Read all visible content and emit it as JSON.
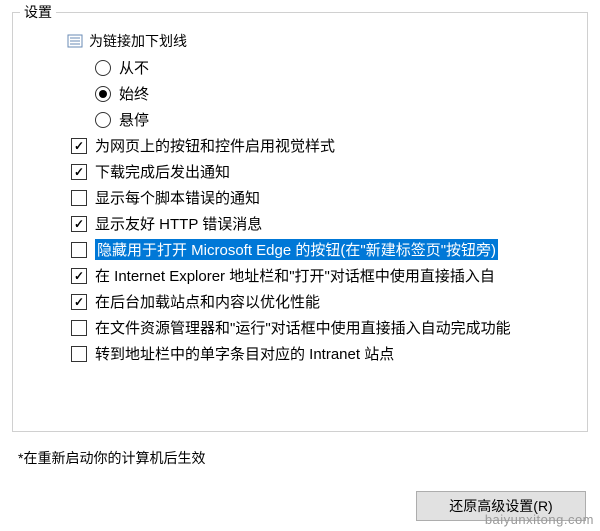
{
  "group_title": "设置",
  "tree": {
    "header": "为链接加下划线",
    "radios": [
      {
        "label": "从不",
        "selected": false
      },
      {
        "label": "始终",
        "selected": true
      },
      {
        "label": "悬停",
        "selected": false
      }
    ],
    "checks": [
      {
        "label": "为网页上的按钮和控件启用视觉样式",
        "checked": true,
        "highlighted": false
      },
      {
        "label": "下载完成后发出通知",
        "checked": true,
        "highlighted": false
      },
      {
        "label": "显示每个脚本错误的通知",
        "checked": false,
        "highlighted": false
      },
      {
        "label": "显示友好 HTTP 错误消息",
        "checked": true,
        "highlighted": false
      },
      {
        "label": "隐藏用于打开 Microsoft Edge 的按钮(在\"新建标签页\"按钮旁)",
        "checked": false,
        "highlighted": true
      },
      {
        "label": "在 Internet Explorer 地址栏和\"打开\"对话框中使用直接插入自",
        "checked": true,
        "highlighted": false
      },
      {
        "label": "在后台加载站点和内容以优化性能",
        "checked": true,
        "highlighted": false
      },
      {
        "label": "在文件资源管理器和\"运行\"对话框中使用直接插入自动完成功能",
        "checked": false,
        "highlighted": false
      },
      {
        "label": "转到地址栏中的单字条目对应的 Intranet 站点",
        "checked": false,
        "highlighted": false
      }
    ]
  },
  "footnote": "*在重新启动你的计算机后生效",
  "buttons": {
    "restore": "还原高级设置(R)"
  },
  "watermark": "baiyunxitong.com"
}
